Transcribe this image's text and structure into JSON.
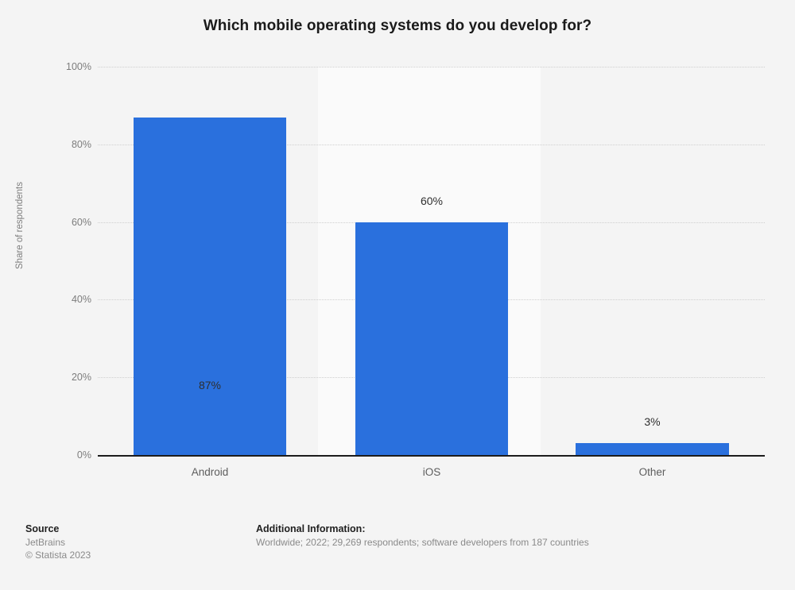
{
  "chart_data": {
    "type": "bar",
    "title": "Which mobile operating systems do you develop for?",
    "categories": [
      "Android",
      "iOS",
      "Other"
    ],
    "values": [
      87,
      60,
      3
    ],
    "value_labels": [
      "87%",
      "60%",
      "3%"
    ],
    "xlabel": "",
    "ylabel": "Share of respondents",
    "ylim": [
      0,
      100
    ],
    "ytick_values": [
      0,
      20,
      40,
      60,
      80,
      100
    ],
    "ytick_labels": [
      "0%",
      "20%",
      "40%",
      "60%",
      "80%",
      "100%"
    ],
    "grid": true,
    "legend": false,
    "bar_color": "#2a70dd",
    "background_color": "#f4f4f4",
    "band_color": "#fafafa"
  },
  "footer": {
    "source_heading": "Source",
    "source_name": "JetBrains",
    "copyright": "© Statista 2023",
    "info_heading": "Additional Information:",
    "info_text": "Worldwide; 2022; 29,269 respondents; software developers from 187 countries"
  }
}
